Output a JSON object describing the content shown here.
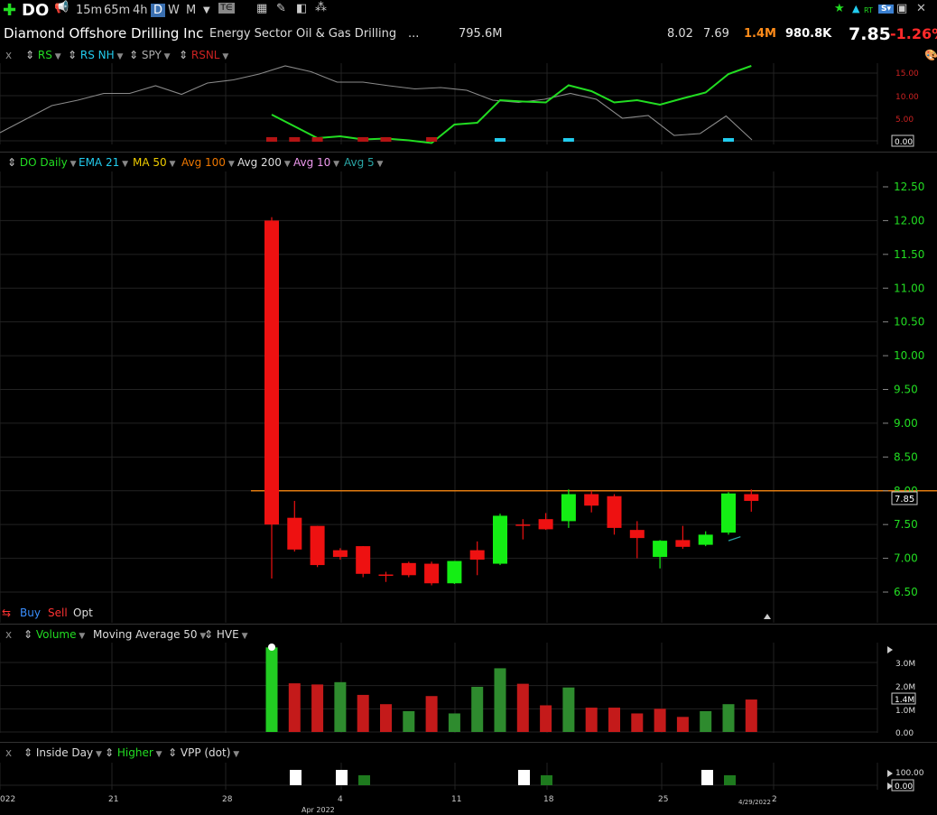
{
  "toolbar": {
    "symbol": "DO",
    "timeframes": [
      "15m",
      "65m",
      "4h",
      "D",
      "W",
      "M"
    ],
    "active_timeframe": "D",
    "rt_label": "RT"
  },
  "info": {
    "company": "Diamond Offshore Drilling Inc",
    "sector": "Energy Sector",
    "industry": "Oil & Gas Drilling",
    "more": "...",
    "market_cap": "795.6M",
    "high": "8.02",
    "low": "7.69",
    "volume": "1.4M",
    "avg_volume": "980.8K",
    "price": "7.85",
    "change": "-1.26%"
  },
  "rs_panel": {
    "close_x": "x",
    "items": [
      {
        "label": "RS",
        "color": "#22dd22"
      },
      {
        "label": "RS NH",
        "color": "#22ccee"
      },
      {
        "label": "SPY",
        "color": "#aaaaaa"
      },
      {
        "label": "RSNL",
        "color": "#cc2222"
      }
    ],
    "ticks": [
      "15.00",
      "10.00",
      "5.00"
    ],
    "last_value": "0.00"
  },
  "price_panel": {
    "items": [
      {
        "label": "DO Daily",
        "color": "#22dd22"
      },
      {
        "label": "EMA 21",
        "color": "#22ccee"
      },
      {
        "label": "MA 50",
        "color": "#eecc00"
      },
      {
        "label": "Avg 100",
        "color": "#ee7700"
      },
      {
        "label": "Avg 200",
        "color": "#dddddd"
      },
      {
        "label": "Avg 10",
        "color": "#ee99ee"
      },
      {
        "label": "Avg 5",
        "color": "#2aa6a6"
      }
    ],
    "price_tag": "7.85",
    "buy": "Buy",
    "sell": "Sell",
    "opt": "Opt"
  },
  "volume_panel": {
    "close_x": "x",
    "items": [
      {
        "label": "Volume",
        "color": "#22dd22"
      },
      {
        "label": "Moving Average 50",
        "color": "#dddddd"
      },
      {
        "label": "HVE",
        "color": "#dddddd"
      }
    ],
    "ticks": [
      "3.0M",
      "2.0M",
      "1.0M",
      "0.00"
    ],
    "tag": "1.4M"
  },
  "inside_panel": {
    "close_x": "x",
    "items": [
      {
        "label": "Inside Day",
        "color": "#dddddd"
      },
      {
        "label": "Higher",
        "color": "#22dd22"
      },
      {
        "label": "VPP (dot)",
        "color": "#dddddd"
      }
    ],
    "ticks": [
      "100.00",
      "0.00"
    ]
  },
  "xaxis": {
    "labels": [
      "022",
      "21",
      "28",
      "4",
      "11",
      "18",
      "25",
      "2"
    ],
    "sub_label": "Apr 2022",
    "date_label": "4/29/2022"
  },
  "chart_data": [
    {
      "type": "candlestick",
      "title": "DO Daily",
      "y_ticks": [
        12.5,
        12.0,
        11.5,
        11.0,
        10.5,
        10.0,
        9.5,
        9.0,
        8.5,
        8.0,
        7.5,
        7.0,
        6.5
      ],
      "ylim": [
        6.2,
        12.8
      ],
      "resistance_line": 8.0,
      "candles": [
        {
          "o": 12.0,
          "h": 12.05,
          "l": 6.7,
          "c": 7.5
        },
        {
          "o": 7.6,
          "h": 7.85,
          "l": 7.1,
          "c": 7.13
        },
        {
          "o": 7.48,
          "h": 7.48,
          "l": 6.87,
          "c": 6.9
        },
        {
          "o": 7.12,
          "h": 7.15,
          "l": 6.98,
          "c": 7.02
        },
        {
          "o": 7.18,
          "h": 7.18,
          "l": 6.72,
          "c": 6.77
        },
        {
          "o": 6.76,
          "h": 6.8,
          "l": 6.65,
          "c": 6.74
        },
        {
          "o": 6.93,
          "h": 6.95,
          "l": 6.72,
          "c": 6.75
        },
        {
          "o": 6.92,
          "h": 6.95,
          "l": 6.6,
          "c": 6.63
        },
        {
          "o": 6.63,
          "h": 6.96,
          "l": 6.62,
          "c": 6.96
        },
        {
          "o": 7.12,
          "h": 7.25,
          "l": 6.75,
          "c": 6.98
        },
        {
          "o": 6.92,
          "h": 7.66,
          "l": 6.9,
          "c": 7.63
        },
        {
          "o": 7.5,
          "h": 7.58,
          "l": 7.28,
          "c": 7.48
        },
        {
          "o": 7.58,
          "h": 7.67,
          "l": 7.42,
          "c": 7.43
        },
        {
          "o": 7.55,
          "h": 8.02,
          "l": 7.45,
          "c": 7.95
        },
        {
          "o": 7.95,
          "h": 8.0,
          "l": 7.68,
          "c": 7.78
        },
        {
          "o": 7.92,
          "h": 7.95,
          "l": 7.35,
          "c": 7.45
        },
        {
          "o": 7.42,
          "h": 7.55,
          "l": 7.0,
          "c": 7.3
        },
        {
          "o": 7.02,
          "h": 7.27,
          "l": 6.85,
          "c": 7.26
        },
        {
          "o": 7.27,
          "h": 7.48,
          "l": 7.14,
          "c": 7.17
        },
        {
          "o": 7.2,
          "h": 7.4,
          "l": 7.18,
          "c": 7.35
        },
        {
          "o": 7.38,
          "h": 7.98,
          "l": 7.35,
          "c": 7.96
        },
        {
          "o": 7.95,
          "h": 8.02,
          "l": 7.69,
          "c": 7.85
        }
      ]
    },
    {
      "type": "bar",
      "title": "Volume",
      "ylim": [
        0,
        3.6
      ],
      "values_millions": [
        3.65,
        2.1,
        2.05,
        2.15,
        1.6,
        1.2,
        0.9,
        1.55,
        0.8,
        1.95,
        2.75,
        2.08,
        1.15,
        1.92,
        1.05,
        1.05,
        0.8,
        1.0,
        0.65,
        0.9,
        1.2,
        1.4
      ],
      "colors": [
        "g",
        "r",
        "r",
        "g",
        "r",
        "r",
        "g",
        "r",
        "g",
        "g",
        "g",
        "r",
        "r",
        "g",
        "r",
        "r",
        "r",
        "r",
        "r",
        "g",
        "g",
        "r"
      ]
    },
    {
      "type": "line",
      "title": "RS",
      "ylim": [
        0,
        18
      ],
      "series": [
        {
          "name": "RS",
          "color": "#22dd22",
          "values": [
            5.8,
            3.2,
            0.6,
            1.0,
            0.3,
            0.5,
            0.1,
            -0.5,
            3.6,
            4.0,
            9.0,
            8.7,
            8.5,
            12.3,
            11.0,
            8.5,
            9.0,
            8.0,
            9.4,
            10.7,
            14.8,
            16.6
          ]
        },
        {
          "name": "SPY",
          "color": "#aaaaaa",
          "values": [
            1.8,
            4.8,
            7.8,
            9.0,
            10.5,
            10.5,
            12.2,
            10.3,
            12.8,
            13.5,
            14.8,
            16.6,
            15.3,
            13.0,
            13.0,
            12.2,
            11.5,
            11.8,
            11.2,
            9.0,
            8.5,
            9.2,
            10.5,
            9.2,
            5.0,
            5.6,
            1.2,
            1.6,
            5.5,
            0.2
          ]
        }
      ]
    }
  ]
}
